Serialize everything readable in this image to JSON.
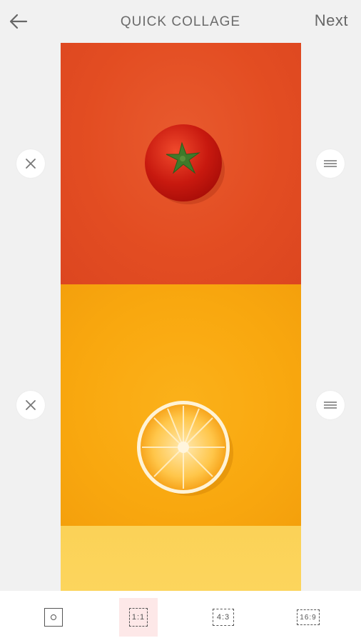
{
  "header": {
    "title": "QUICK COLLAGE",
    "next_label": "Next",
    "back_icon": "arrow-left-icon"
  },
  "collage": {
    "tiles": [
      {
        "subject": "tomato",
        "color": "#e34d22"
      },
      {
        "subject": "orange-slice",
        "color": "#f9a80f"
      },
      {
        "subject": "yellow",
        "color": "#fcd55d"
      }
    ],
    "remove_icon": "close-icon",
    "reorder_icon": "drag-handle-icon"
  },
  "toolbar": {
    "ratios": [
      {
        "label": "",
        "icon": "circle-in-square-icon"
      },
      {
        "label": "1:1",
        "active": true
      },
      {
        "label": "4:3"
      },
      {
        "label": "16:9"
      }
    ],
    "active_color": "#fde8e8"
  }
}
